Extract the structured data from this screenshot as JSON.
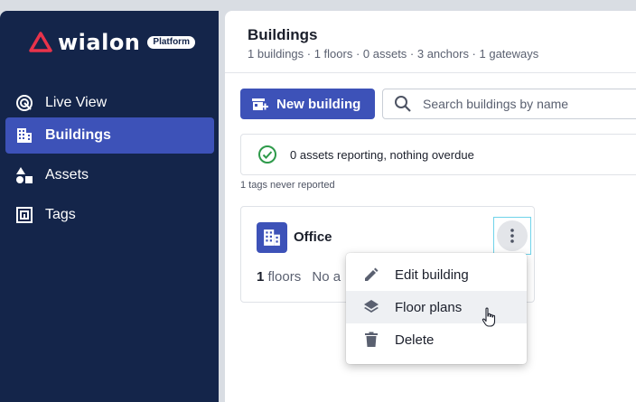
{
  "brand": {
    "name": "wialon",
    "badge": "Platform",
    "logo_color": "#e8334b"
  },
  "sidebar": {
    "items": [
      {
        "label": "Live View",
        "icon": "live-view-icon",
        "active": false
      },
      {
        "label": "Buildings",
        "icon": "building-icon",
        "active": true
      },
      {
        "label": "Assets",
        "icon": "shapes-icon",
        "active": false
      },
      {
        "label": "Tags",
        "icon": "tag-icon",
        "active": false
      }
    ]
  },
  "header": {
    "title": "Buildings",
    "subtitle": "1 buildings · 1 floors · 0 assets · 3 anchors · 1 gateways"
  },
  "toolbar": {
    "new_label": "New building",
    "search_placeholder": "Search buildings by name",
    "search_value": ""
  },
  "status": {
    "text": "0 assets reporting, nothing overdue",
    "never_reported": "1 tags never reported"
  },
  "building_card": {
    "name": "Office",
    "floors_count": "1",
    "floors_label": "floors",
    "truncated_text": "No a"
  },
  "context_menu": {
    "items": [
      {
        "label": "Edit building",
        "icon": "pencil-icon"
      },
      {
        "label": "Floor plans",
        "icon": "layers-icon",
        "hovered": true
      },
      {
        "label": "Delete",
        "icon": "trash-icon"
      }
    ]
  },
  "colors": {
    "sidebar_bg": "#14254a",
    "accent": "#3d52b8",
    "success": "#2e9a4a",
    "focus_ring": "#6fd3ea"
  }
}
